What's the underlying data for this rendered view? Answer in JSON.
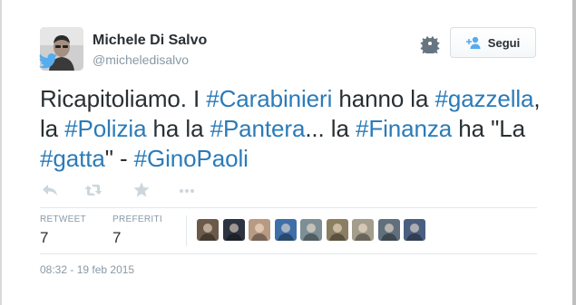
{
  "author": {
    "name": "Michele Di Salvo",
    "handle": "@micheledisalvo"
  },
  "follow_button": {
    "label": "Segui"
  },
  "tweet": {
    "segments": [
      {
        "text": "Ricapitoliamo. I ",
        "hashtag": false
      },
      {
        "text": "#Carabinieri",
        "hashtag": true
      },
      {
        "text": " hanno la ",
        "hashtag": false
      },
      {
        "text": "#gazzella",
        "hashtag": true
      },
      {
        "text": ", la ",
        "hashtag": false
      },
      {
        "text": "#Polizia",
        "hashtag": true
      },
      {
        "text": " ha la ",
        "hashtag": false
      },
      {
        "text": "#Pantera",
        "hashtag": true
      },
      {
        "text": "... la ",
        "hashtag": false
      },
      {
        "text": "#Finanza",
        "hashtag": true
      },
      {
        "text": " ha \"La ",
        "hashtag": false
      },
      {
        "text": "#gatta",
        "hashtag": true
      },
      {
        "text": "\" - ",
        "hashtag": false
      },
      {
        "text": "#GinoPaoli",
        "hashtag": true
      }
    ]
  },
  "actions": [
    "reply-icon",
    "retweet-icon",
    "favorite-icon",
    "more-icon"
  ],
  "stats": {
    "retweets": {
      "label": "RETWEET",
      "value": "7"
    },
    "favorites": {
      "label": "PREFERITI",
      "value": "7"
    }
  },
  "favoriters_avatar_colors": [
    "#6b5a4a",
    "#2d3440",
    "#b89a82",
    "#3e6fa8",
    "#7d8f95",
    "#8a7e62",
    "#a49c8c",
    "#5f6f7c",
    "#4a5f80"
  ],
  "timestamp": "08:32 - 19 feb 2015",
  "colors": {
    "hashtag": "#2b7bb9",
    "text": "#292f33",
    "muted": "#8899a6",
    "twitter_blue": "#55acee"
  }
}
